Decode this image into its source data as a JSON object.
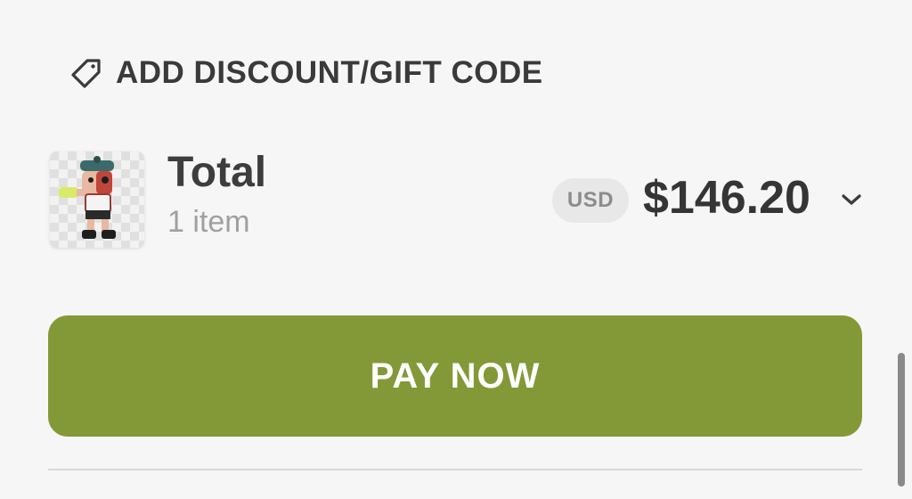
{
  "discount": {
    "label": "ADD DISCOUNT/GIFT CODE",
    "icon": "tag-icon"
  },
  "summary": {
    "title": "Total",
    "item_count": "1 item",
    "currency": "USD",
    "amount": "$146.20",
    "toggle_icon": "chevron-down-icon",
    "thumbnail": "product-thumbnail"
  },
  "pay_button": {
    "label": "PAY NOW",
    "color": "#839937"
  },
  "colors": {
    "background": "#f6f6f6",
    "text_primary": "#3a3a3a",
    "text_muted": "#a0a0a0",
    "badge_bg": "#e8e8e8",
    "accent": "#839937"
  }
}
